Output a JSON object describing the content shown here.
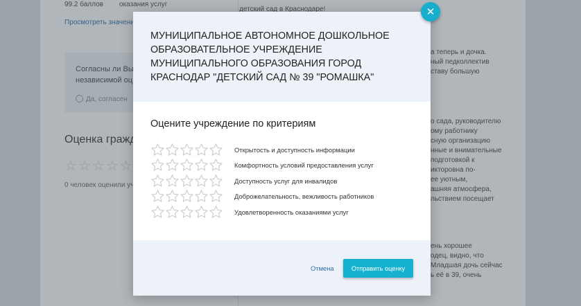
{
  "background": {
    "score_small": "99.2 баллов",
    "services_small": "оказания услуг",
    "view_link": "Просмотреть значения",
    "agree_question_1": "Согласны ли Вы",
    "agree_question_2": "независимой оц",
    "agree_button": "Да, согласен",
    "rating_heading": "Оценка гражд",
    "rated_count": "0 человек оценили уч",
    "right_text": [
      "детский сад в Краснодаре!",
      "а теперь и дочка.",
      "ный педколлектив",
      "ставу большую",
      "",
      "о сада, руководителю",
      "ому работнику",
      "сную организацию",
      "нные и внимательные",
      "подготовкой к",
      "икторовна по-",
      "ее уютным,",
      "ашняя атмосфера,",
      "льствием посещает",
      "",
      "ень хорошее",
      "одец, видно, что",
      "Младшая дочь сейчас",
      "ь её в 39, очень"
    ]
  },
  "modal": {
    "title": "МУНИЦИПАЛЬНОЕ АВТОНОМНОЕ ДОШКОЛЬНОЕ ОБРАЗОВАТЕЛЬНОЕ УЧРЕЖДЕНИЕ МУНИЦИПАЛЬНОГО ОБРАЗОВАНИЯ ГОРОД КРАСНОДАР \"ДЕТСКИЙ САД № 39 \"РОМАШКА\"",
    "subtitle": "Оцените учреждение по критериям",
    "criteria": [
      {
        "label": "Открытость и доступность информации",
        "rating": 0,
        "max": 5
      },
      {
        "label": "Комфортность условий предоставления услуг",
        "rating": 0,
        "max": 5
      },
      {
        "label": "Доступность услуг для инвалидов",
        "rating": 0,
        "max": 5
      },
      {
        "label": "Доброжелательность, вежливость работников",
        "rating": 0,
        "max": 5
      },
      {
        "label": "Удовлетворенность оказаниями услуг",
        "rating": 0,
        "max": 5
      }
    ],
    "cancel_label": "Отмена",
    "submit_label": "Отправить оценку",
    "close_symbol": "✕"
  },
  "icons": {
    "star": "star-outline-icon",
    "close": "close-icon",
    "check": "check-circle-icon"
  },
  "colors": {
    "accent": "#16b1cf",
    "link": "#2d6ea8",
    "modal_band": "#edf1f8",
    "star_outline": "#c8cdd2"
  }
}
